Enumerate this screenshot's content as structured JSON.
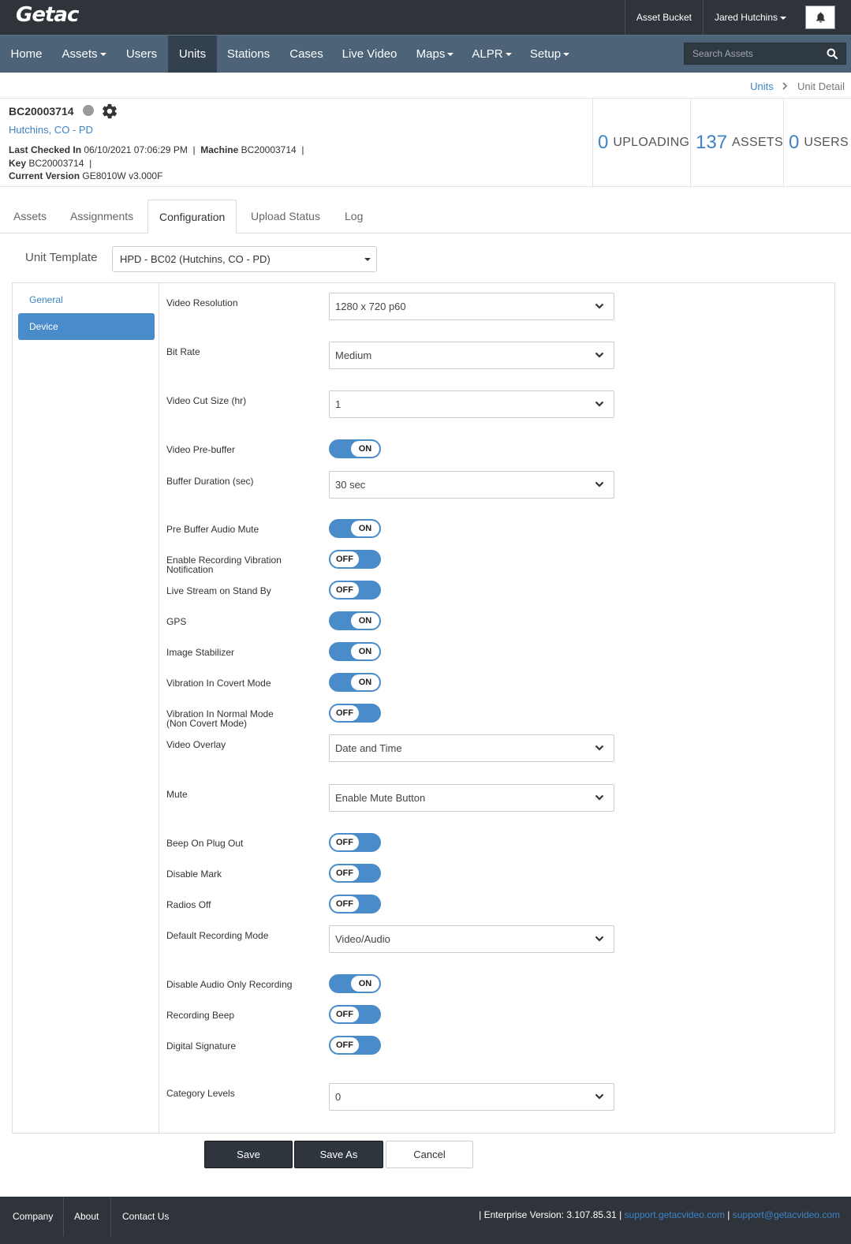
{
  "header": {
    "logo": "Getac",
    "asset_bucket": "Asset Bucket",
    "user_name": "Jared Hutchins"
  },
  "nav": {
    "items": [
      "Home",
      "Assets",
      "Users",
      "Units",
      "Stations",
      "Cases",
      "Live Video",
      "Maps",
      "ALPR",
      "Setup"
    ],
    "active": "Units",
    "search_placeholder": "Search Assets"
  },
  "breadcrumb": {
    "parent": "Units",
    "current": "Unit Detail"
  },
  "unit": {
    "id": "BC20003714",
    "agency": "Hutchins, CO - PD",
    "last_checked_label": "Last Checked In",
    "last_checked": "06/10/2021 07:06:29 PM",
    "machine_label": "Machine",
    "machine": "BC20003714",
    "key_label": "Key",
    "key": "BC20003714",
    "version_label": "Current Version",
    "version": "GE8010W v3.000F",
    "status_color": "#9a9a9a"
  },
  "stats": [
    {
      "value": "0",
      "label": "UPLOADING"
    },
    {
      "value": "137",
      "label": "ASSETS"
    },
    {
      "value": "0",
      "label": "USERS"
    }
  ],
  "tabs": [
    "Assets",
    "Assignments",
    "Configuration",
    "Upload Status",
    "Log"
  ],
  "active_tab": "Configuration",
  "template": {
    "label": "Unit Template",
    "value": "HPD - BC02 (Hutchins, CO - PD)"
  },
  "sidebar": {
    "items": [
      "General",
      "Device"
    ],
    "active": "Device"
  },
  "settings": [
    {
      "label": "Video Resolution",
      "type": "select",
      "value": "1280 x 720 p60"
    },
    {
      "label": "Bit Rate",
      "type": "select",
      "value": "Medium"
    },
    {
      "label": "Video Cut Size (hr)",
      "type": "select",
      "value": "1"
    },
    {
      "label": "Video Pre-buffer",
      "type": "toggle",
      "value": "ON"
    },
    {
      "label": "Buffer Duration (sec)",
      "type": "select",
      "value": "30 sec"
    },
    {
      "label": "Pre Buffer Audio Mute",
      "type": "toggle",
      "value": "ON"
    },
    {
      "label": "Enable Recording Vibration Notification",
      "type": "toggle",
      "value": "OFF"
    },
    {
      "label": "Live Stream on Stand By",
      "type": "toggle",
      "value": "OFF"
    },
    {
      "label": "GPS",
      "type": "toggle",
      "value": "ON"
    },
    {
      "label": "Image Stabilizer",
      "type": "toggle",
      "value": "ON"
    },
    {
      "label": "Vibration In Covert Mode",
      "type": "toggle",
      "value": "ON"
    },
    {
      "label": "Vibration In Normal Mode (Non Covert Mode)",
      "type": "toggle",
      "value": "OFF"
    },
    {
      "label": "Video Overlay",
      "type": "select",
      "value": "Date and Time"
    },
    {
      "label": "Mute",
      "type": "select",
      "value": "Enable Mute Button"
    },
    {
      "label": "Beep On Plug Out",
      "type": "toggle",
      "value": "OFF"
    },
    {
      "label": "Disable Mark",
      "type": "toggle",
      "value": "OFF"
    },
    {
      "label": "Radios Off",
      "type": "toggle",
      "value": "OFF"
    },
    {
      "label": "Default Recording Mode",
      "type": "select",
      "value": "Video/Audio"
    },
    {
      "label": "Disable Audio Only Recording",
      "type": "toggle",
      "value": "ON"
    },
    {
      "label": "Recording Beep",
      "type": "toggle",
      "value": "OFF"
    },
    {
      "label": "Digital Signature",
      "type": "toggle",
      "value": "OFF"
    },
    {
      "label": "Category Levels",
      "type": "select",
      "value": "0"
    }
  ],
  "buttons": {
    "save": "Save",
    "save_as": "Save As",
    "cancel": "Cancel"
  },
  "footer": {
    "links": [
      "Company",
      "About",
      "Contact Us"
    ],
    "version_label": "Enterprise Version:",
    "version": "3.107.85.31",
    "support_site": "support.getacvideo.com",
    "support_email": "support@getacvideo.com"
  },
  "colors": {
    "accent": "#3d84c6",
    "topbar": "#2f343b",
    "navbar": "#4c6378",
    "nav_active": "#33414f",
    "toggle": "#4a8bc9"
  }
}
